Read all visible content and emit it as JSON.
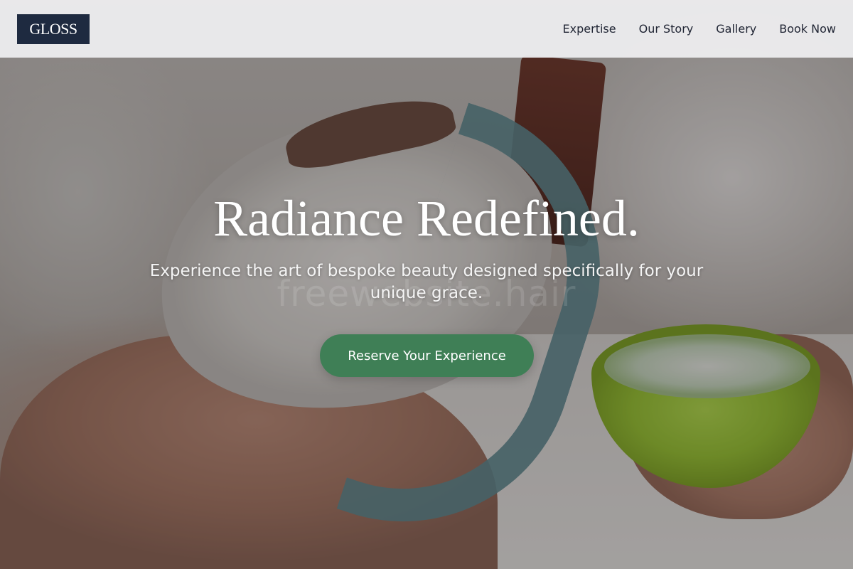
{
  "header": {
    "logo_text": "GLOSS",
    "nav": [
      {
        "label": "Expertise"
      },
      {
        "label": "Our Story"
      },
      {
        "label": "Gallery"
      },
      {
        "label": "Book Now"
      }
    ]
  },
  "hero": {
    "title": "Radiance Redefined.",
    "subtitle": "Experience the art of bespoke beauty designed specifically for your unique grace.",
    "watermark": "freewebsite.hair",
    "cta_label": "Reserve Your Experience",
    "image_subject": "woman receiving facial mask treatment with green bowl of cream"
  },
  "colors": {
    "logo_bg": "#1e2a40",
    "header_bg": "#ececee",
    "cta_bg": "#3f7f56",
    "nav_text": "#1f2433"
  }
}
